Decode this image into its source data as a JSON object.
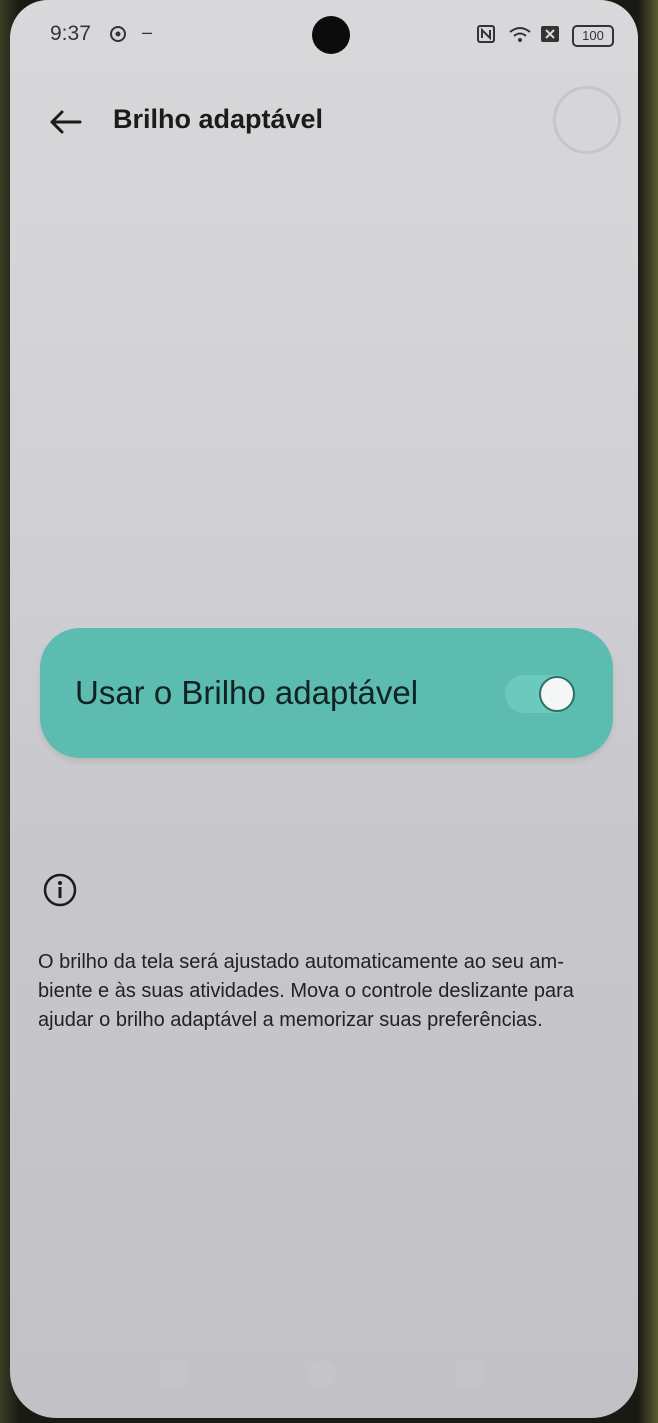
{
  "status_bar": {
    "time": "9:37",
    "battery": "100",
    "icons": [
      "settings-icon",
      "minus-icon",
      "nfc-icon",
      "wifi-icon",
      "no-sim-icon",
      "battery-icon"
    ]
  },
  "header": {
    "title": "Brilho adaptável",
    "back_icon": "arrow-left-icon"
  },
  "setting": {
    "label": "Usar o Brilho adaptável",
    "enabled": true,
    "accent_color": "#5cbcb0"
  },
  "info": {
    "icon": "info-icon",
    "text": "O brilho da tela será ajustado automaticamente ao seu am-biente e às suas atividades. Mova o controle deslizante para ajudar o brilho adaptável a memorizar suas preferências."
  }
}
